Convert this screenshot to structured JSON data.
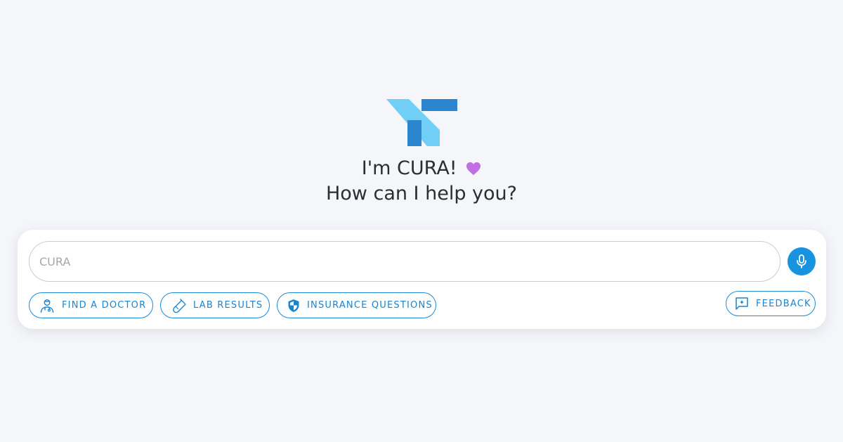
{
  "greeting": {
    "line1": "I'm CURA!",
    "line2": "How can I help you?"
  },
  "search": {
    "placeholder": "CURA",
    "value": ""
  },
  "actions": {
    "find_doctor": "FIND A DOCTOR",
    "lab_results": "LAB RESULTS",
    "insurance": "INSURANCE QUESTIONS",
    "feedback": "FEEDBACK"
  },
  "icons": {
    "logo": "cura-logo-icon",
    "heart": "heart-icon",
    "mic": "microphone-icon",
    "doctor": "doctor-icon",
    "test_tube": "test-tube-icon",
    "shield": "shield-icon",
    "feedback": "feedback-icon"
  },
  "colors": {
    "accent": "#1793df",
    "logo_light": "#6fcff7",
    "logo_dark": "#2b86cf",
    "heart": "#c46ee6",
    "background": "#f5f6fa"
  }
}
